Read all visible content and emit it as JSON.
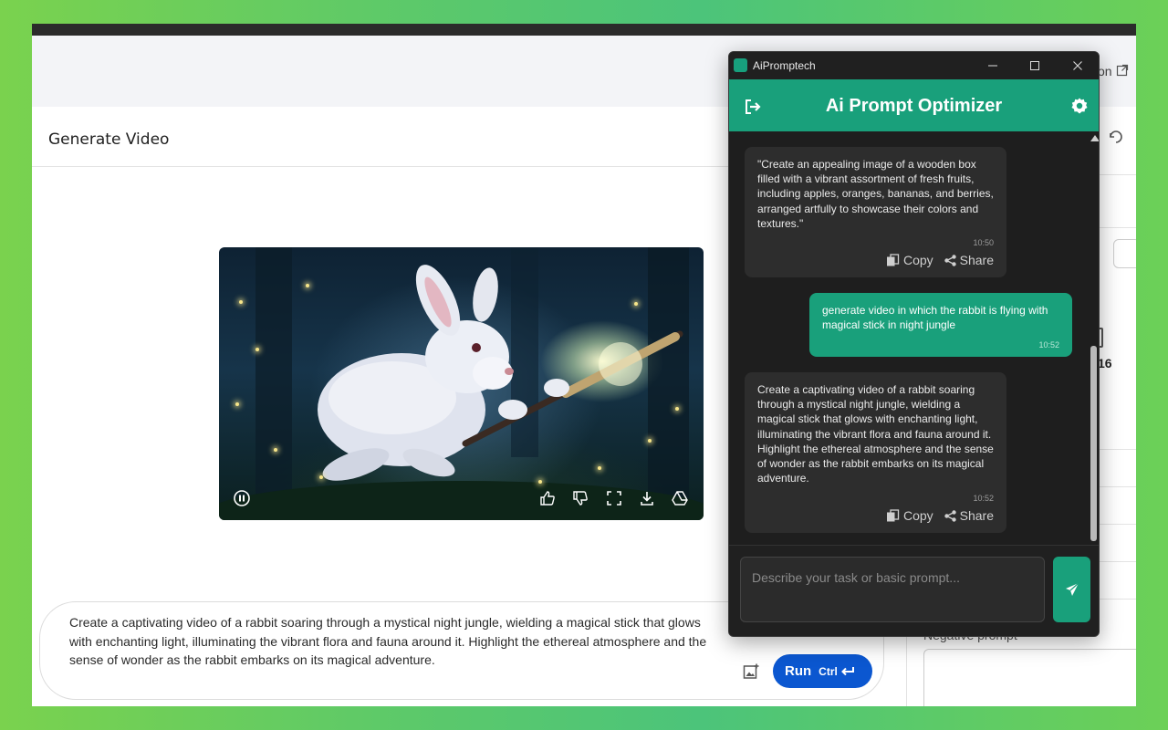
{
  "background_page": {
    "title": "Generate Video",
    "partial_link_text": "on",
    "aspect_label_partial": "16",
    "negative_prompt_label": "Negative prompt",
    "prompt_text": "Create a captivating video of a rabbit soaring through a mystical night jungle, wielding a magical stick that glows with enchanting light, illuminating the vibrant flora and fauna around it. Highlight the ethereal atmosphere and the sense of wonder as the rabbit embarks on its magical adventure.",
    "run_label": "Run",
    "run_shortcut": "Ctrl",
    "video_controls": [
      "pause-icon",
      "thumbs-up-icon",
      "thumbs-down-icon",
      "fullscreen-icon",
      "download-icon",
      "drive-icon"
    ]
  },
  "popup": {
    "window_title": "AiPromptech",
    "app_title": "Ai Prompt Optimizer",
    "accent_color": "#19a07b",
    "messages": [
      {
        "role": "bot",
        "text": "\"Create an appealing image of a wooden box filled with a vibrant assortment of fresh fruits, including apples, oranges, bananas, and berries, arranged artfully to showcase their colors and textures.\"",
        "time": "10:50",
        "copy_label": "Copy",
        "share_label": "Share"
      },
      {
        "role": "user",
        "text": "generate video in which the rabbit is flying with magical stick in night jungle",
        "time": "10:52"
      },
      {
        "role": "bot",
        "text": "Create a captivating video of a rabbit soaring through a mystical night jungle, wielding a magical stick that glows with enchanting light, illuminating the vibrant flora and fauna around it. Highlight the ethereal atmosphere and the sense of wonder as the rabbit embarks on its magical adventure.",
        "time": "10:52",
        "copy_label": "Copy",
        "share_label": "Share"
      }
    ],
    "input_placeholder": "Describe your task or basic prompt..."
  }
}
